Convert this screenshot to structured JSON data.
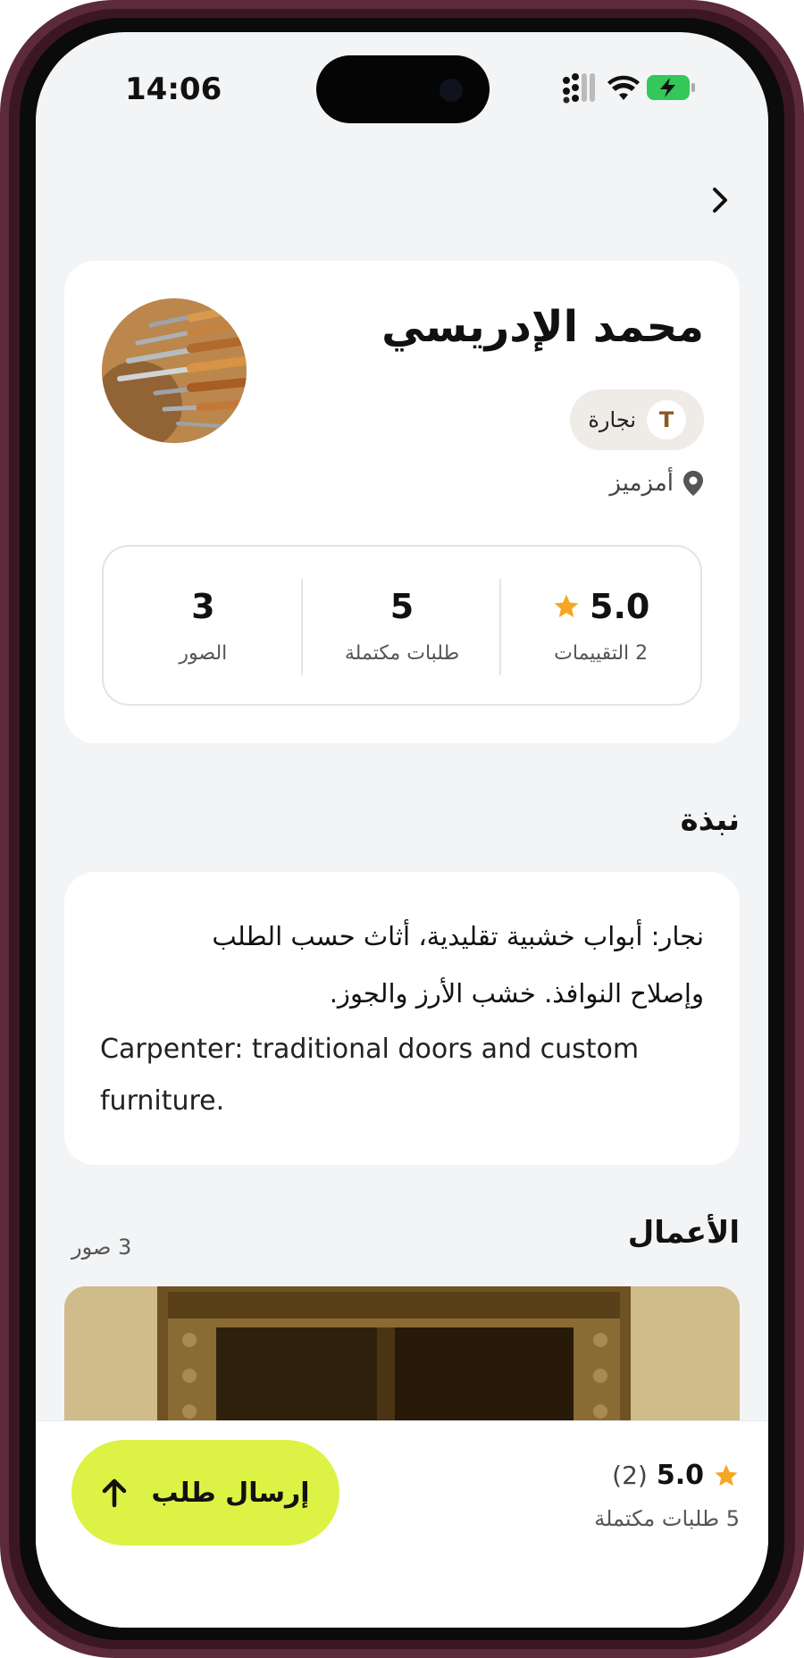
{
  "status_bar": {
    "time": "14:06"
  },
  "profile": {
    "name": "محمد الإدريسي",
    "trade": "نجارة",
    "trade_icon": "T",
    "location": "أمزميز"
  },
  "stats": {
    "rating_value": "5.0",
    "rating_label": "2 التقييمات",
    "orders_value": "5",
    "orders_label": "طلبات مكتملة",
    "photos_value": "3",
    "photos_label": "الصور"
  },
  "about": {
    "title": "نبذة",
    "text_ar": "نجار: أبواب خشبية تقليدية، أثاث حسب الطلب وإصلاح النوافذ. خشب الأرز والجوز.",
    "text_en": "Carpenter: traditional doors and custom furniture."
  },
  "works": {
    "title": "الأعمال",
    "count": "3 صور"
  },
  "bottom_bar": {
    "rating_value": "5.0",
    "rating_count": "(2)",
    "completed": "5 طلبات مكتملة",
    "send_button": "إرسال طلب"
  },
  "colors": {
    "accent": "#dcf245",
    "star": "#f5a623",
    "phone_frame": "#5c2a3a",
    "background": "#f3f4f6"
  },
  "icons": [
    "back-chevron-icon",
    "location-pin-icon",
    "star-icon",
    "arrow-up-icon",
    "signal-icon",
    "wifi-icon",
    "battery-charging-icon"
  ]
}
